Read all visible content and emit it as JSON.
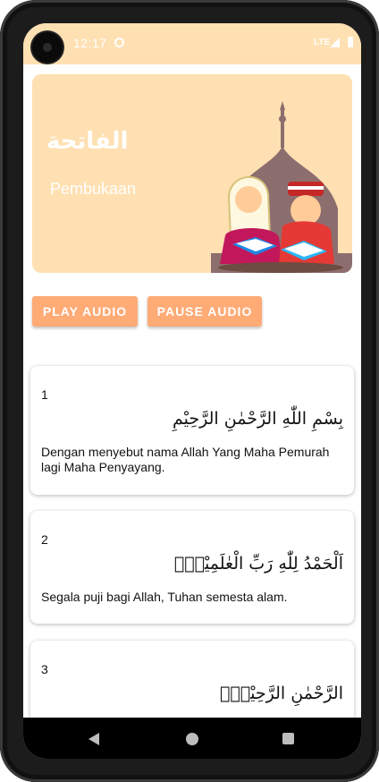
{
  "status_bar": {
    "time": "12:17",
    "network": "LTE",
    "icons": [
      "camera-icon",
      "app-notification-icon",
      "signal-icon",
      "battery-icon"
    ]
  },
  "header": {
    "surah_arabic": "الفاتحة",
    "surah_latin": "Pembukaan",
    "background_color": "#ffe0b2"
  },
  "controls": {
    "play_label": "PLAY AUDIO",
    "pause_label": "PAUSE AUDIO",
    "button_color": "#ffab76"
  },
  "ayahs": [
    {
      "number": "1",
      "arabic": "بِسْمِ اللّٰهِ الرَّحْمٰنِ الرَّحِيْمِ",
      "translation": "Dengan menyebut nama Allah Yang Maha Pemurah lagi Maha Penyayang."
    },
    {
      "number": "2",
      "arabic": "اَلْحَمْدُ لِلّٰهِ رَبِّ الْعٰلَمِيْنَۙ",
      "translation": "Segala puji bagi Allah, Tuhan semesta alam."
    },
    {
      "number": "3",
      "arabic": "الرَّحْمٰنِ الرَّحِيْمِۙ",
      "translation": ""
    }
  ],
  "nav_bar": {
    "icons": [
      "back-icon",
      "home-icon",
      "recents-icon"
    ]
  }
}
